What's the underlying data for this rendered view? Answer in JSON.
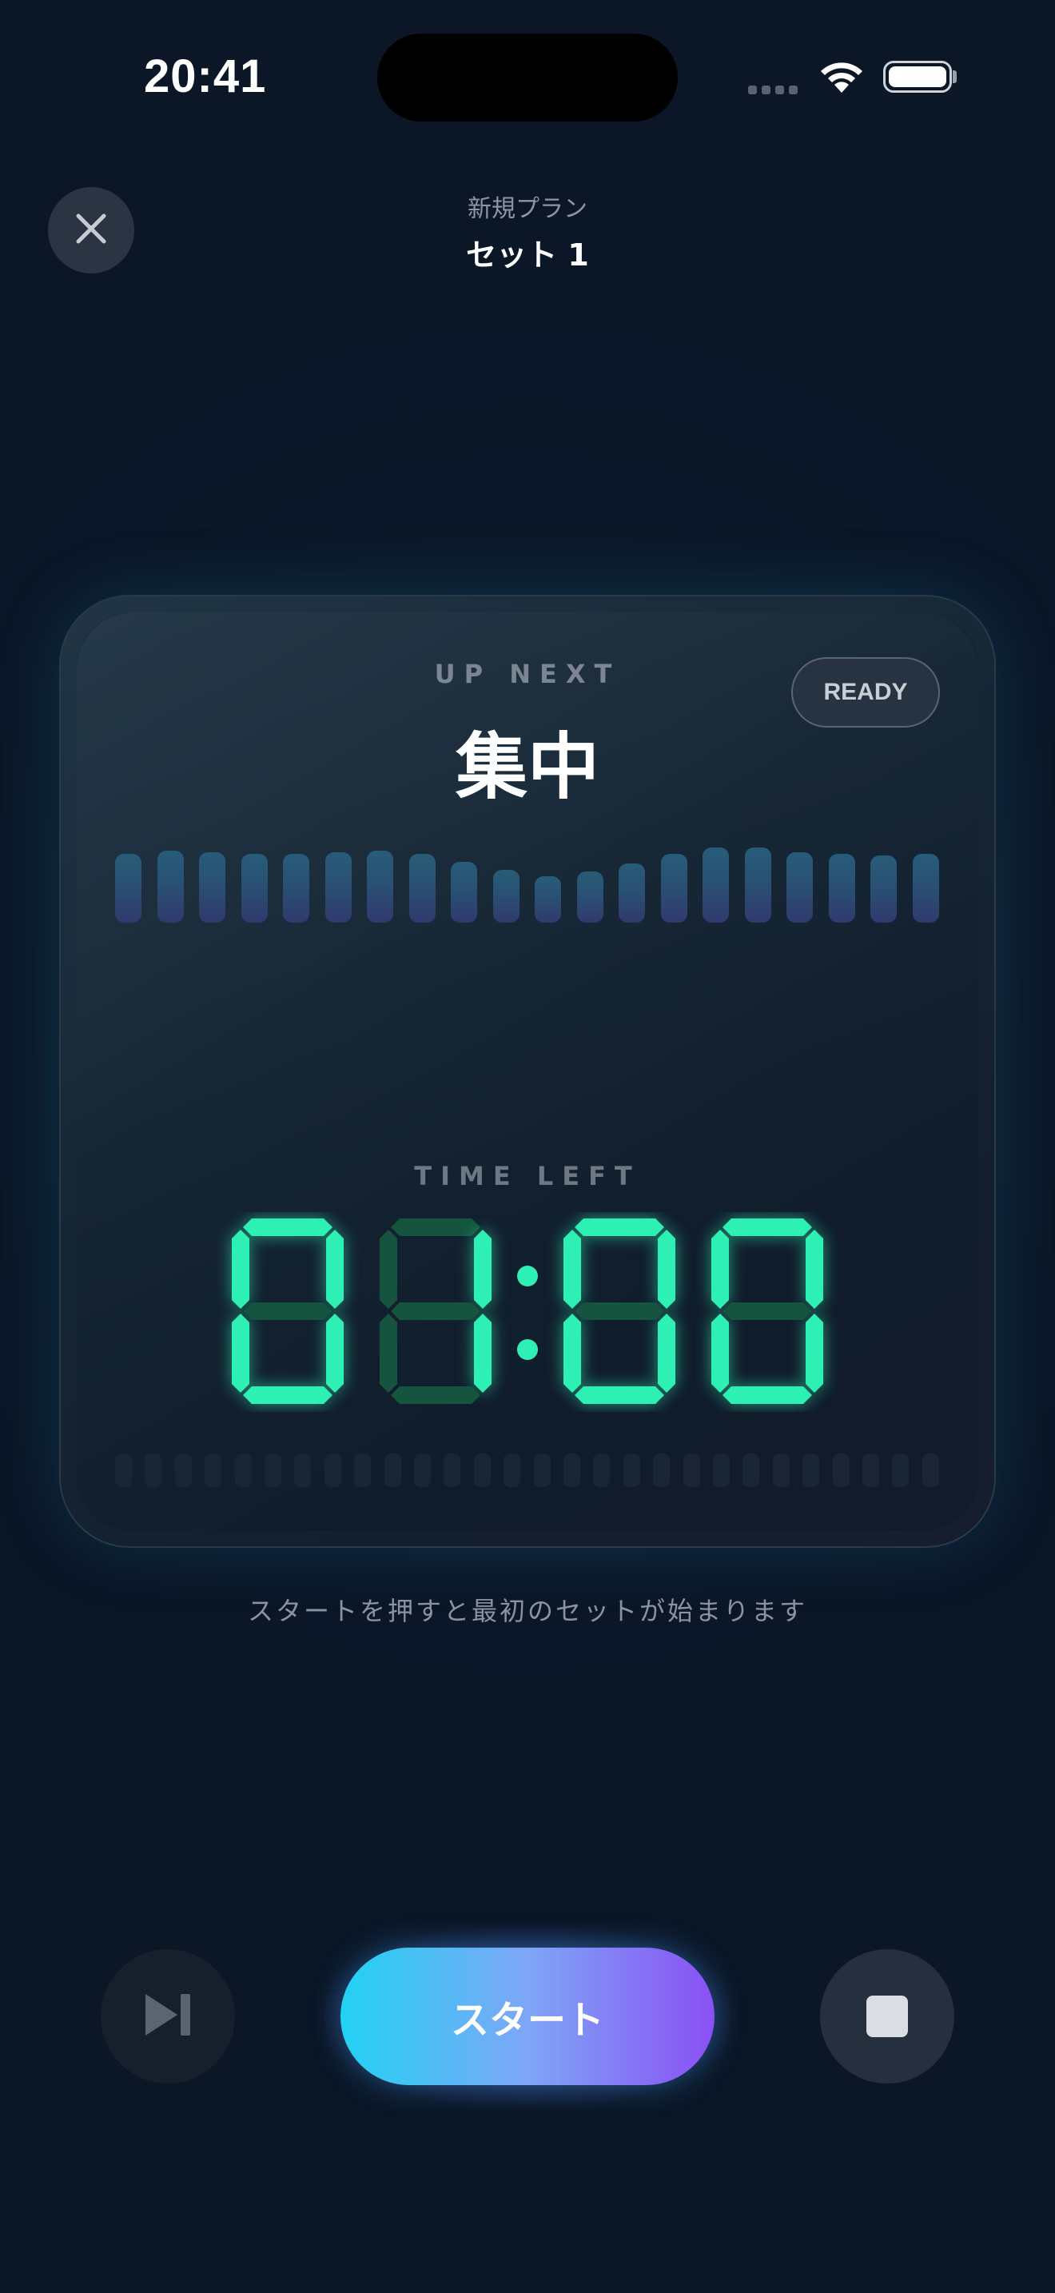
{
  "status_bar": {
    "time": "20:41",
    "icons": [
      "cellular-signal-icon",
      "wifi-icon",
      "battery-icon"
    ]
  },
  "header": {
    "close_icon": "close-icon",
    "subtitle": "新規プラン",
    "title": "セット 1"
  },
  "card": {
    "up_next_label": "UP NEXT",
    "phase_name": "集中",
    "status_badge": "READY",
    "time_left_label": "TIME LEFT",
    "time_display": "01:00"
  },
  "hint": "スタートを押すと最初のセットが始まります",
  "controls": {
    "skip_icon": "skip-next-icon",
    "start_label": "スタート",
    "stop_icon": "stop-icon"
  },
  "colors": {
    "accent_digit": "#2ff0b4",
    "start_gradient_start": "#22d2f3",
    "start_gradient_end": "#8a50f5",
    "background": "#0b1627"
  }
}
